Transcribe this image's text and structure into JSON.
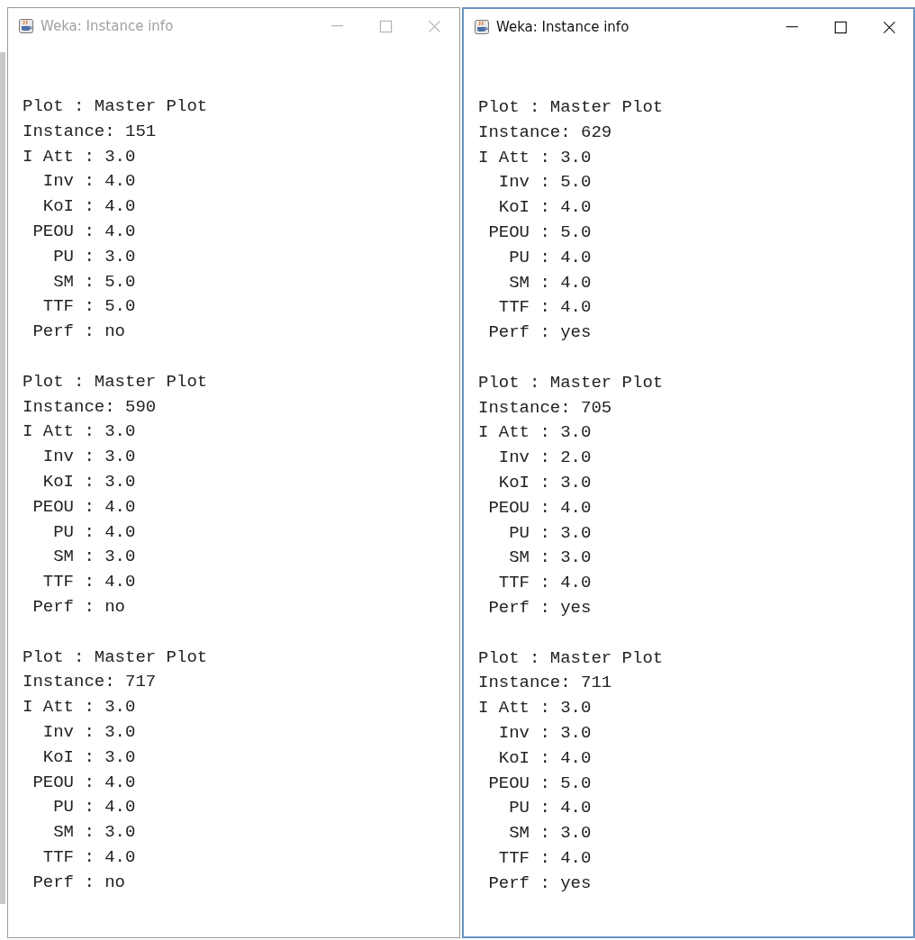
{
  "windows": [
    {
      "title": "Weka: Instance info",
      "active": false,
      "records": [
        {
          "lines": [
            "Plot : Master Plot",
            "Instance: 151",
            "I Att : 3.0",
            "  Inv : 4.0",
            "  KoI : 4.0",
            " PEOU : 4.0",
            "   PU : 3.0",
            "   SM : 5.0",
            "  TTF : 5.0",
            " Perf : no"
          ]
        },
        {
          "lines": [
            "Plot : Master Plot",
            "Instance: 590",
            "I Att : 3.0",
            "  Inv : 3.0",
            "  KoI : 3.0",
            " PEOU : 4.0",
            "   PU : 4.0",
            "   SM : 3.0",
            "  TTF : 4.0",
            " Perf : no"
          ]
        },
        {
          "lines": [
            "Plot : Master Plot",
            "Instance: 717",
            "I Att : 3.0",
            "  Inv : 3.0",
            "  KoI : 3.0",
            " PEOU : 4.0",
            "   PU : 4.0",
            "   SM : 3.0",
            "  TTF : 4.0",
            " Perf : no"
          ]
        }
      ]
    },
    {
      "title": "Weka: Instance info",
      "active": true,
      "records": [
        {
          "lines": [
            "Plot : Master Plot",
            "Instance: 629",
            "I Att : 3.0",
            "  Inv : 5.0",
            "  KoI : 4.0",
            " PEOU : 5.0",
            "   PU : 4.0",
            "   SM : 4.0",
            "  TTF : 4.0",
            " Perf : yes"
          ]
        },
        {
          "lines": [
            "Plot : Master Plot",
            "Instance: 705",
            "I Att : 3.0",
            "  Inv : 2.0",
            "  KoI : 3.0",
            " PEOU : 4.0",
            "   PU : 3.0",
            "   SM : 3.0",
            "  TTF : 4.0",
            " Perf : yes"
          ]
        },
        {
          "lines": [
            "Plot : Master Plot",
            "Instance: 711",
            "I Att : 3.0",
            "  Inv : 3.0",
            "  KoI : 4.0",
            " PEOU : 5.0",
            "   PU : 4.0",
            "   SM : 3.0",
            "  TTF : 4.0",
            " Perf : yes"
          ]
        }
      ]
    }
  ]
}
